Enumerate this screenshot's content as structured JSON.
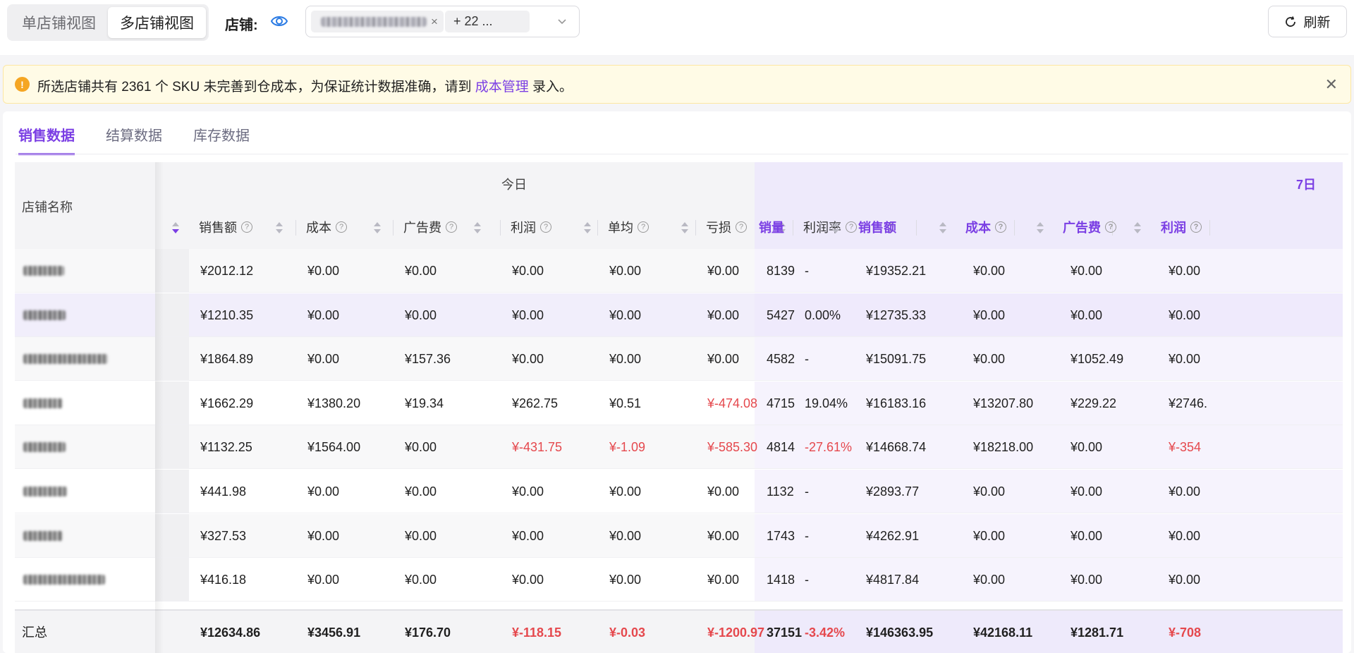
{
  "view_toggle": {
    "single": "单店铺视图",
    "multi": "多店铺视图",
    "active": "multi"
  },
  "store_filter": {
    "label": "店铺:",
    "tag_more": "+ 22 ..."
  },
  "refresh_label": "刷新",
  "alert": {
    "prefix": "所选店铺共有 2361 个 SKU 未完善到仓成本，为保证统计数据准确，请到 ",
    "link": "成本管理",
    "suffix": " 录入。"
  },
  "tabs": [
    {
      "label": "销售数据",
      "active": true
    },
    {
      "label": "结算数据",
      "active": false
    },
    {
      "label": "库存数据",
      "active": false
    }
  ],
  "table": {
    "store_name_header": "店铺名称",
    "group_today": "今日",
    "group_week": "7日",
    "today_columns": [
      "销售额",
      "成本",
      "广告费",
      "利润",
      "单均",
      "亏损",
      "利润率"
    ],
    "week_columns": [
      "销量",
      "销售额",
      "成本",
      "广告费",
      "利润"
    ],
    "rows": [
      {
        "today": [
          "¥2012.12",
          "¥0.00",
          "¥0.00",
          "¥0.00",
          "¥0.00",
          "¥0.00",
          "-"
        ],
        "week": [
          "8139",
          "¥19352.21",
          "¥0.00",
          "¥0.00",
          "¥0.00"
        ]
      },
      {
        "today": [
          "¥1210.35",
          "¥0.00",
          "¥0.00",
          "¥0.00",
          "¥0.00",
          "¥0.00",
          "0.00%"
        ],
        "week": [
          "5427",
          "¥12735.33",
          "¥0.00",
          "¥0.00",
          "¥0.00"
        ]
      },
      {
        "today": [
          "¥1864.89",
          "¥0.00",
          "¥157.36",
          "¥0.00",
          "¥0.00",
          "¥0.00",
          "-"
        ],
        "week": [
          "4582",
          "¥15091.75",
          "¥0.00",
          "¥1052.49",
          "¥0.00"
        ]
      },
      {
        "today": [
          "¥1662.29",
          "¥1380.20",
          "¥19.34",
          "¥262.75",
          "¥0.51",
          "¥-474.08",
          "19.04%"
        ],
        "week": [
          "4715",
          "¥16183.16",
          "¥13207.80",
          "¥229.22",
          "¥2746."
        ]
      },
      {
        "today": [
          "¥1132.25",
          "¥1564.00",
          "¥0.00",
          "¥-431.75",
          "¥-1.09",
          "¥-585.30",
          "-27.61%"
        ],
        "week": [
          "4814",
          "¥14668.74",
          "¥18218.00",
          "¥0.00",
          "¥-354"
        ]
      },
      {
        "today": [
          "¥441.98",
          "¥0.00",
          "¥0.00",
          "¥0.00",
          "¥0.00",
          "¥0.00",
          "-"
        ],
        "week": [
          "1132",
          "¥2893.77",
          "¥0.00",
          "¥0.00",
          "¥0.00"
        ]
      },
      {
        "today": [
          "¥327.53",
          "¥0.00",
          "¥0.00",
          "¥0.00",
          "¥0.00",
          "¥0.00",
          "-"
        ],
        "week": [
          "1743",
          "¥4262.91",
          "¥0.00",
          "¥0.00",
          "¥0.00"
        ]
      },
      {
        "today": [
          "¥416.18",
          "¥0.00",
          "¥0.00",
          "¥0.00",
          "¥0.00",
          "¥0.00",
          "-"
        ],
        "week": [
          "1418",
          "¥4817.84",
          "¥0.00",
          "¥0.00",
          "¥0.00"
        ]
      }
    ],
    "total": {
      "label": "汇总",
      "today": [
        "¥12634.86",
        "¥3456.91",
        "¥176.70",
        "¥-118.15",
        "¥-0.03",
        "¥-1200.97",
        "-3.42%"
      ],
      "week": [
        "37151",
        "¥146363.95",
        "¥42168.11",
        "¥1281.71",
        "¥-708"
      ]
    }
  },
  "colors": {
    "accent": "#7b3fe4",
    "negative": "#e5484d",
    "warning": "#f5a623"
  }
}
